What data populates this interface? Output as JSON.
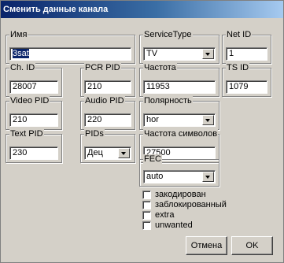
{
  "window": {
    "title": "Сменить данные канала"
  },
  "fields": {
    "name": {
      "label": "Имя",
      "value": "3sat"
    },
    "service_type": {
      "label": "ServiceType",
      "value": "TV"
    },
    "net_id": {
      "label": "Net ID",
      "value": "1"
    },
    "ch_id": {
      "label": "Ch. ID",
      "value": "28007"
    },
    "pcr_pid": {
      "label": "PCR PID",
      "value": "210"
    },
    "frequency": {
      "label": "Частота",
      "value": "11953"
    },
    "ts_id": {
      "label": "TS ID",
      "value": "1079"
    },
    "video_pid": {
      "label": "Video PID",
      "value": "210"
    },
    "audio_pid": {
      "label": "Audio PID",
      "value": "220"
    },
    "polarity": {
      "label": "Полярность",
      "value": "hor"
    },
    "text_pid": {
      "label": "Text PID",
      "value": "230"
    },
    "pids": {
      "label": "PIDs",
      "value": "Дец"
    },
    "symbol_rate": {
      "label": "Частота символов",
      "value": "27500"
    },
    "fec": {
      "label": "FEC",
      "value": "auto"
    }
  },
  "checkboxes": {
    "encoded": {
      "label": "закодирован",
      "checked": false
    },
    "blocked": {
      "label": "заблокированный",
      "checked": false
    },
    "extra": {
      "label": "extra",
      "checked": false
    },
    "unwanted": {
      "label": "unwanted",
      "checked": false
    }
  },
  "buttons": {
    "cancel": "Отмена",
    "ok": "OK"
  }
}
